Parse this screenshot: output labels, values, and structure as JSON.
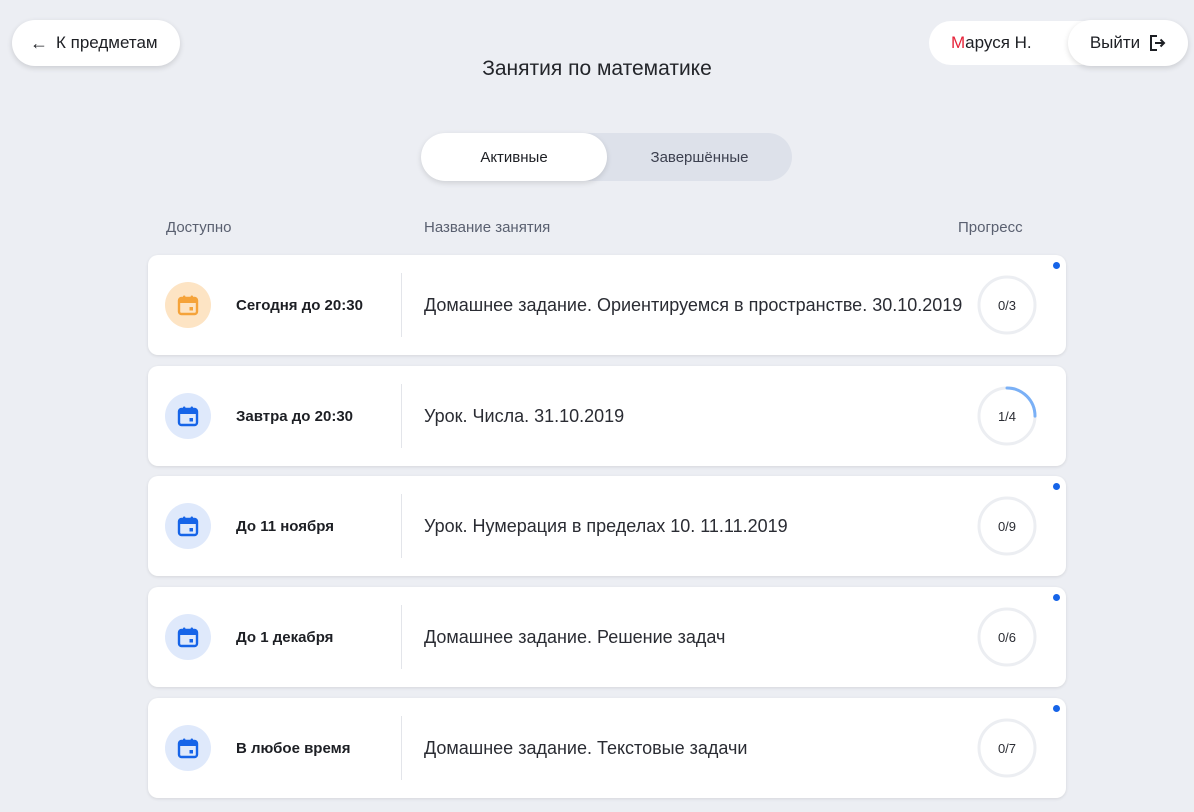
{
  "header": {
    "back_label": "К предметам",
    "title": "Занятия по математике",
    "user_initial": "М",
    "user_rest": "аруся Н.",
    "logout_label": "Выйти"
  },
  "tabs": [
    {
      "label": "Активные",
      "active": true
    },
    {
      "label": "Завершённые",
      "active": false
    }
  ],
  "columns": {
    "available": "Доступно",
    "name": "Название занятия",
    "progress": "Прогресс"
  },
  "lessons": [
    {
      "available": "Сегодня до 20:30",
      "title": "Домашнее задание. Ориентируемся в пространстве. 30.10.2019",
      "progress": "0/3",
      "done": 0,
      "total": 3,
      "icon_color": "orange",
      "new": true
    },
    {
      "available": "Завтра до 20:30",
      "title": "Урок. Числа. 31.10.2019",
      "progress": "1/4",
      "done": 1,
      "total": 4,
      "icon_color": "blue",
      "new": false
    },
    {
      "available": "До 11 ноября",
      "title": "Урок. Нумерация в пределах 10. 11.11.2019",
      "progress": "0/9",
      "done": 0,
      "total": 9,
      "icon_color": "blue",
      "new": true
    },
    {
      "available": "До 1 декабря",
      "title": "Домашнее задание. Решение задач",
      "progress": "0/6",
      "done": 0,
      "total": 6,
      "icon_color": "blue",
      "new": true
    },
    {
      "available": "В любое время",
      "title": "Домашнее задание. Текстовые задачи",
      "progress": "0/7",
      "done": 0,
      "total": 7,
      "icon_color": "blue",
      "new": true
    }
  ],
  "colors": {
    "accent": "#1664e8",
    "orange_icon": "#f5a33a",
    "user_initial": "#e6243a"
  },
  "icons": {
    "back": "arrow-left-icon",
    "logout": "logout-icon",
    "calendar": "calendar-icon"
  }
}
